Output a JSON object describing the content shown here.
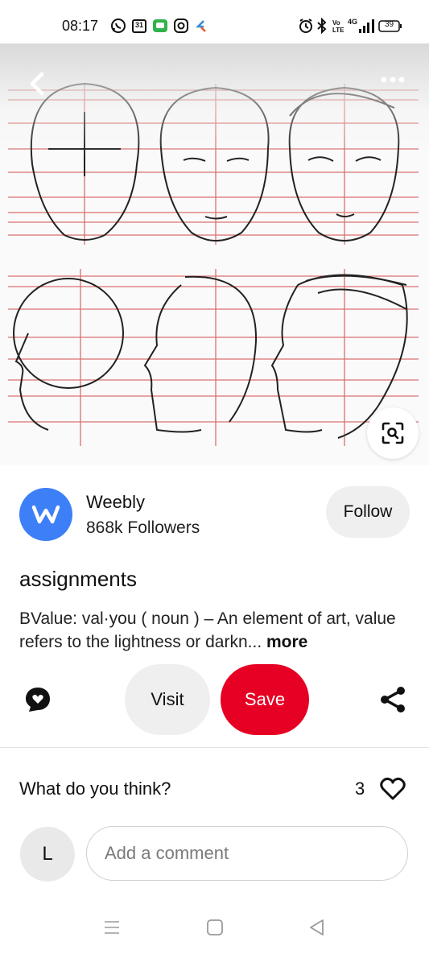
{
  "status_bar": {
    "time": "08:17",
    "calendar_day": "31",
    "network_label": "4G",
    "battery": "39",
    "icons": [
      "whatsapp-icon",
      "calendar-icon",
      "messages-icon",
      "instagram-icon",
      "kite-icon",
      "alarm-icon",
      "bluetooth-icon",
      "volte-icon",
      "signal-icon",
      "battery-icon"
    ]
  },
  "hero": {
    "icons": [
      "back-icon",
      "more-icon",
      "visual-search-icon"
    ]
  },
  "creator": {
    "avatar_letter": "W",
    "name": "Weebly",
    "followers": "868k Followers",
    "follow_label": "Follow"
  },
  "pin": {
    "title": "assignments",
    "description": "BValue:  val·you ( noun ) – An element of art, value refers to the lightness or darkn...",
    "more_label": "more"
  },
  "actions": {
    "visit_label": "Visit",
    "save_label": "Save",
    "save_color": "#e60023"
  },
  "comments": {
    "heading": "What do you think?",
    "reaction_count": "3",
    "user_initial": "L",
    "input_placeholder": "Add a comment"
  },
  "nav_bar": {
    "icons": [
      "recent-apps-icon",
      "home-icon",
      "back-nav-icon"
    ]
  }
}
